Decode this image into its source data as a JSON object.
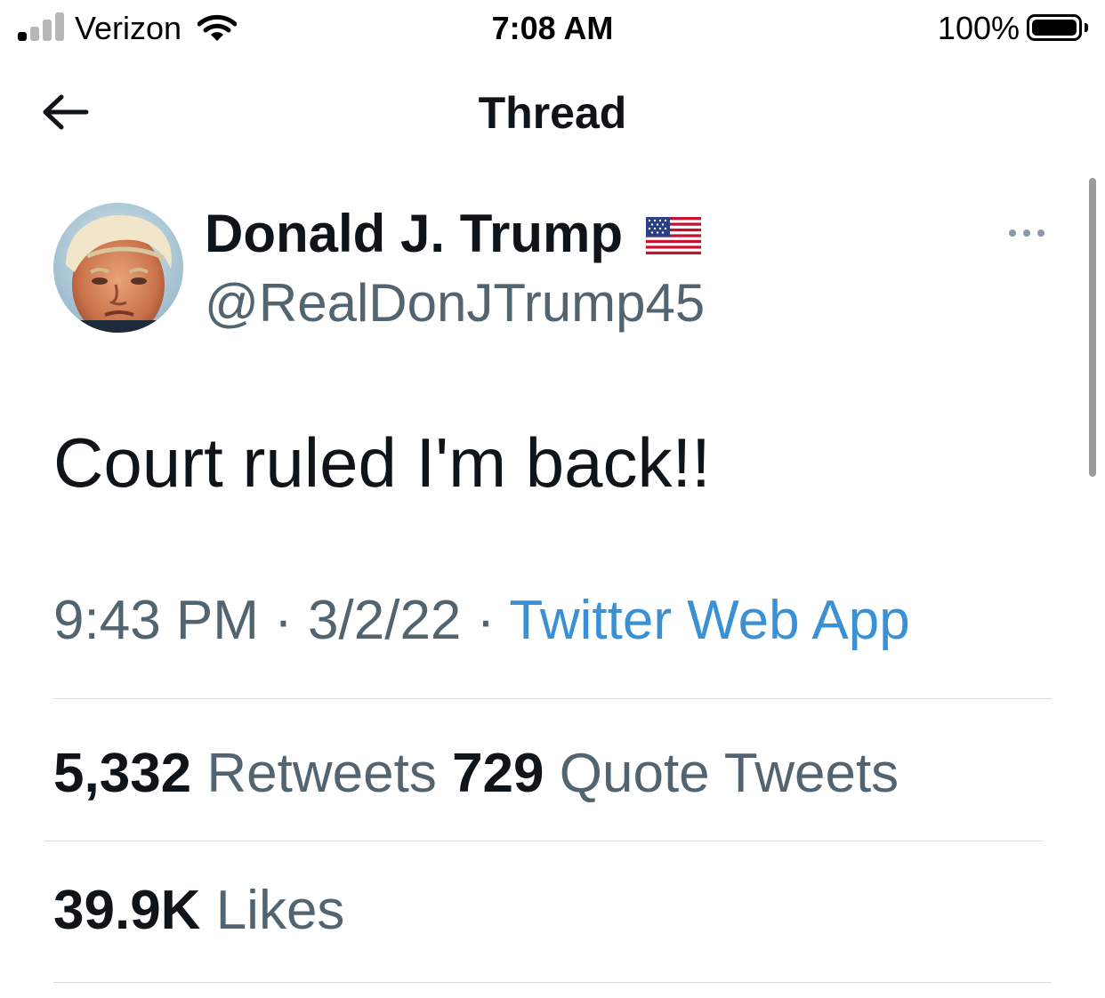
{
  "status_bar": {
    "carrier": "Verizon",
    "time": "7:08 AM",
    "battery_percent": "100%",
    "signal_bars_filled": 1,
    "signal_bars_total": 4
  },
  "header": {
    "title": "Thread",
    "back_icon": "arrow-left-icon"
  },
  "tweet": {
    "author": {
      "display_name": "Donald J. Trump",
      "handle": "@RealDonJTrump45",
      "badge_icon": "us-flag-icon"
    },
    "text": "Court ruled I'm back!!",
    "timestamp_time": "9:43 PM",
    "separator": "·",
    "timestamp_date": "3/2/22",
    "source": "Twitter Web App",
    "stats": {
      "retweets_count": "5,332",
      "retweets_label": "Retweets",
      "quote_tweets_count": "729",
      "quote_tweets_label": "Quote Tweets",
      "likes_count": "39.9K",
      "likes_label": "Likes"
    }
  },
  "colors": {
    "primary_text": "#0f1419",
    "secondary_text": "#536471",
    "link": "#3a90d4",
    "divider": "#d6dbdf"
  }
}
